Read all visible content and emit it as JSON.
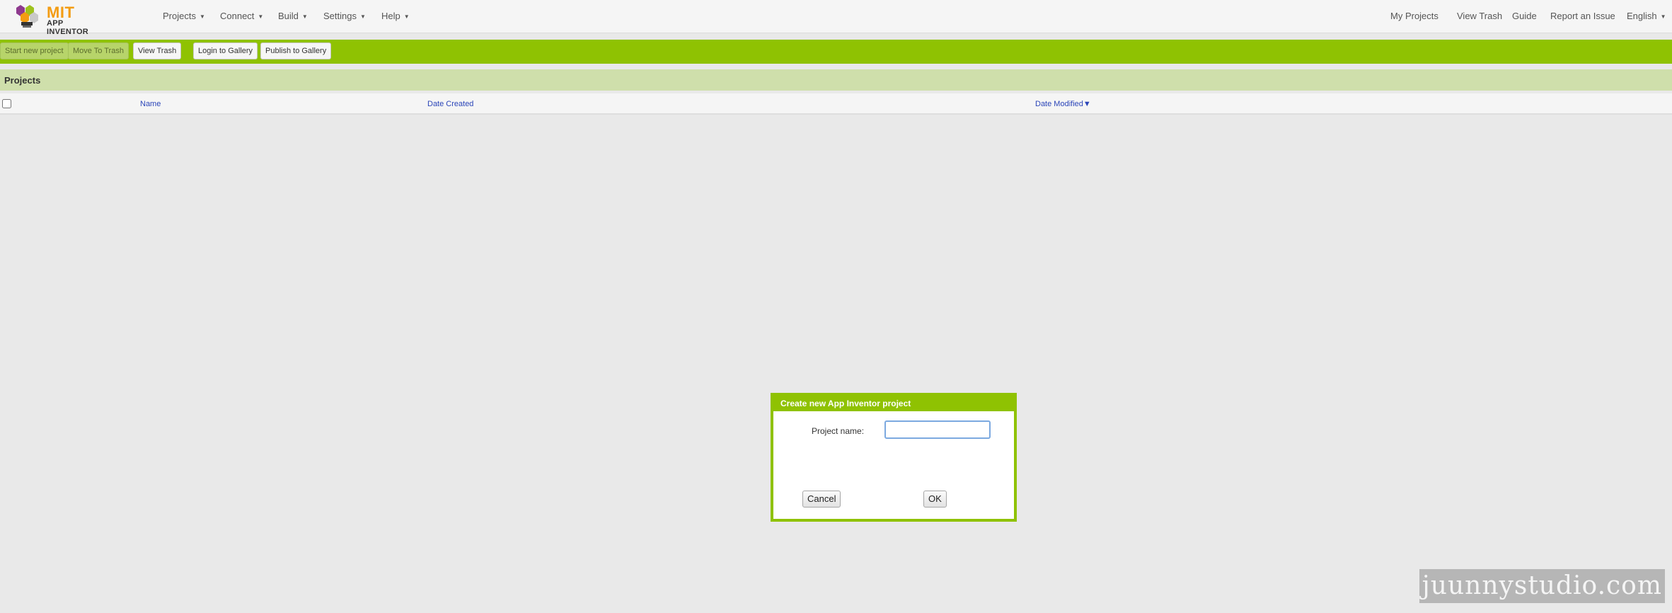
{
  "brand": {
    "line1": "MIT",
    "line2": "APP INVENTOR"
  },
  "nav_left": [
    "Projects",
    "Connect",
    "Build",
    "Settings",
    "Help"
  ],
  "nav_right": [
    "My Projects",
    "View Trash",
    "Guide",
    "Report an Issue",
    "English"
  ],
  "toolbar": {
    "start_new": "Start new project",
    "move_trash": "Move To Trash",
    "view_trash": "View Trash",
    "login_gallery": "Login to Gallery",
    "publish_gallery": "Publish to Gallery"
  },
  "projects": {
    "title": "Projects",
    "columns": {
      "name": "Name",
      "created": "Date Created",
      "modified": "Date Modified",
      "sort_glyph": "▼"
    }
  },
  "dialog": {
    "title": "Create new App Inventor project",
    "label": "Project name:",
    "value": "",
    "cancel": "Cancel",
    "ok": "OK"
  },
  "watermark": "juunnystudio.com",
  "colors": {
    "accent": "#8fc202",
    "header_bg": "#cfdfab",
    "link": "#2b45b8",
    "logo_orange": "#f39c12"
  }
}
